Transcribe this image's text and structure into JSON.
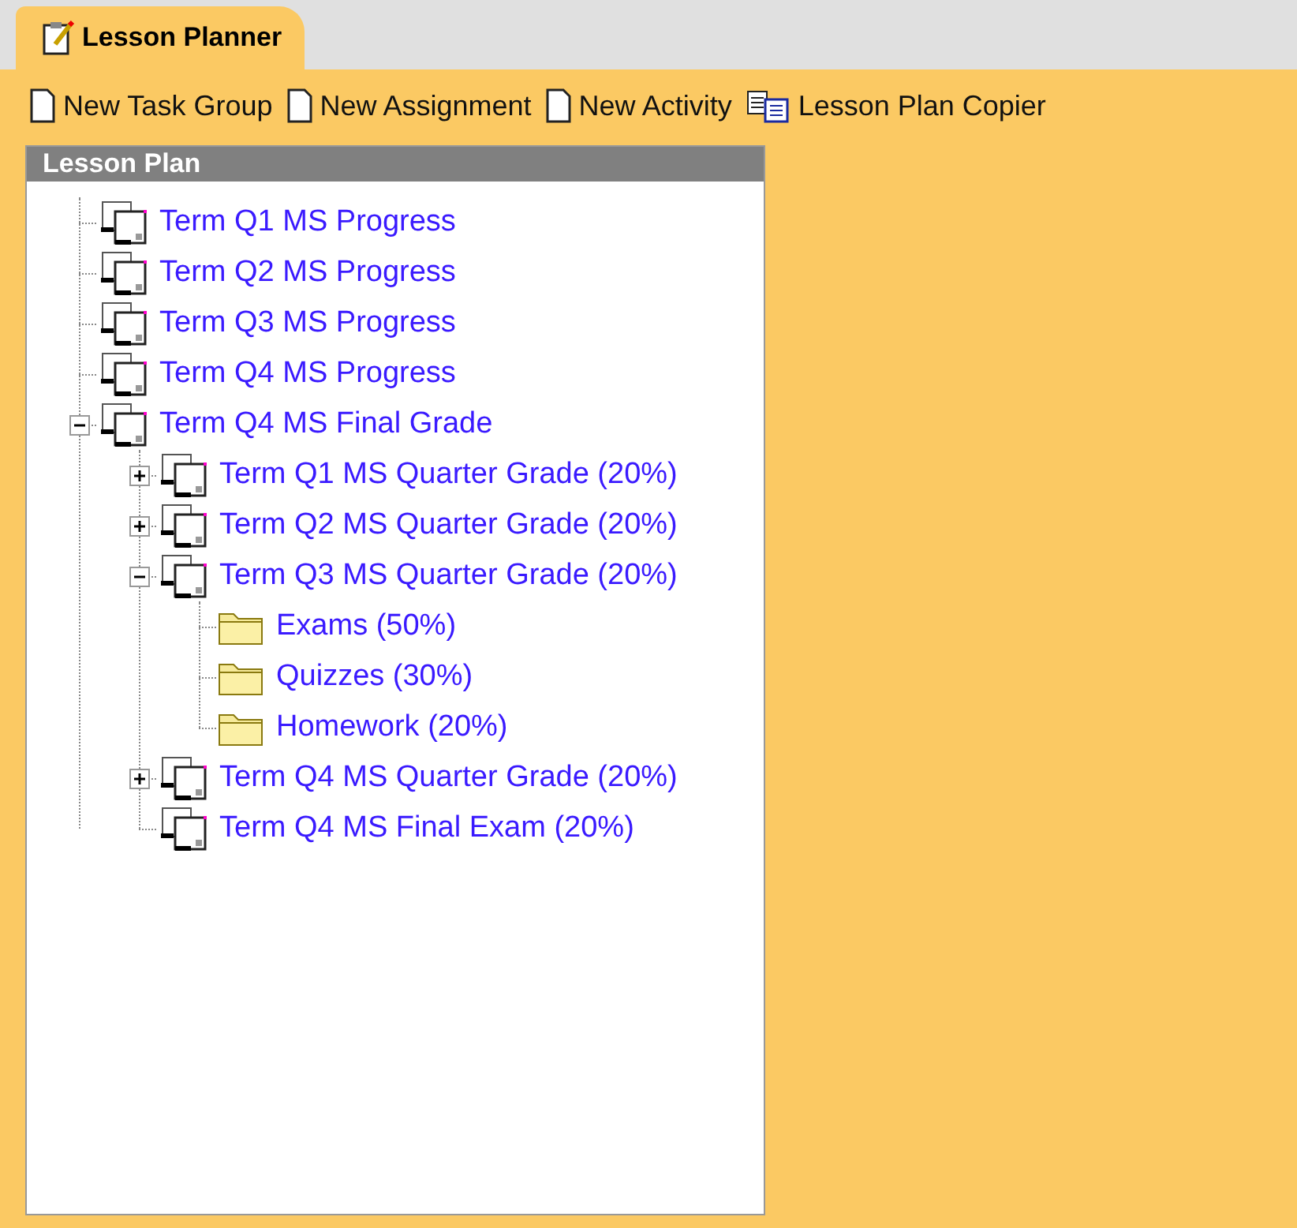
{
  "tabs": [
    {
      "label": "Lesson Planner",
      "selected": true
    }
  ],
  "toolbar": [
    {
      "label": "New Task Group",
      "kind": "page"
    },
    {
      "label": "New Assignment",
      "kind": "page"
    },
    {
      "label": "New Activity",
      "kind": "page"
    },
    {
      "label": "Lesson Plan Copier",
      "kind": "copier"
    }
  ],
  "panel": {
    "title": "Lesson Plan",
    "tree": [
      {
        "label": "Term Q1 MS Progress",
        "kind": "group"
      },
      {
        "label": "Term Q2 MS Progress",
        "kind": "group"
      },
      {
        "label": "Term Q3 MS Progress",
        "kind": "group"
      },
      {
        "label": "Term Q4 MS Progress",
        "kind": "group"
      },
      {
        "label": "Term Q4 MS Final Grade",
        "kind": "group",
        "expanded": true,
        "children": [
          {
            "label": "Term Q1 MS Quarter Grade (20%)",
            "kind": "group",
            "expanded": false
          },
          {
            "label": "Term Q2 MS Quarter Grade (20%)",
            "kind": "group",
            "expanded": false
          },
          {
            "label": "Term Q3 MS Quarter Grade (20%)",
            "kind": "group",
            "expanded": true,
            "children": [
              {
                "label": "Exams (50%)",
                "kind": "folder"
              },
              {
                "label": "Quizzes (30%)",
                "kind": "folder"
              },
              {
                "label": "Homework (20%)",
                "kind": "folder"
              }
            ]
          },
          {
            "label": "Term Q4 MS Quarter Grade (20%)",
            "kind": "group",
            "expanded": false
          },
          {
            "label": "Term Q4 MS Final Exam (20%)",
            "kind": "group"
          }
        ]
      }
    ]
  }
}
